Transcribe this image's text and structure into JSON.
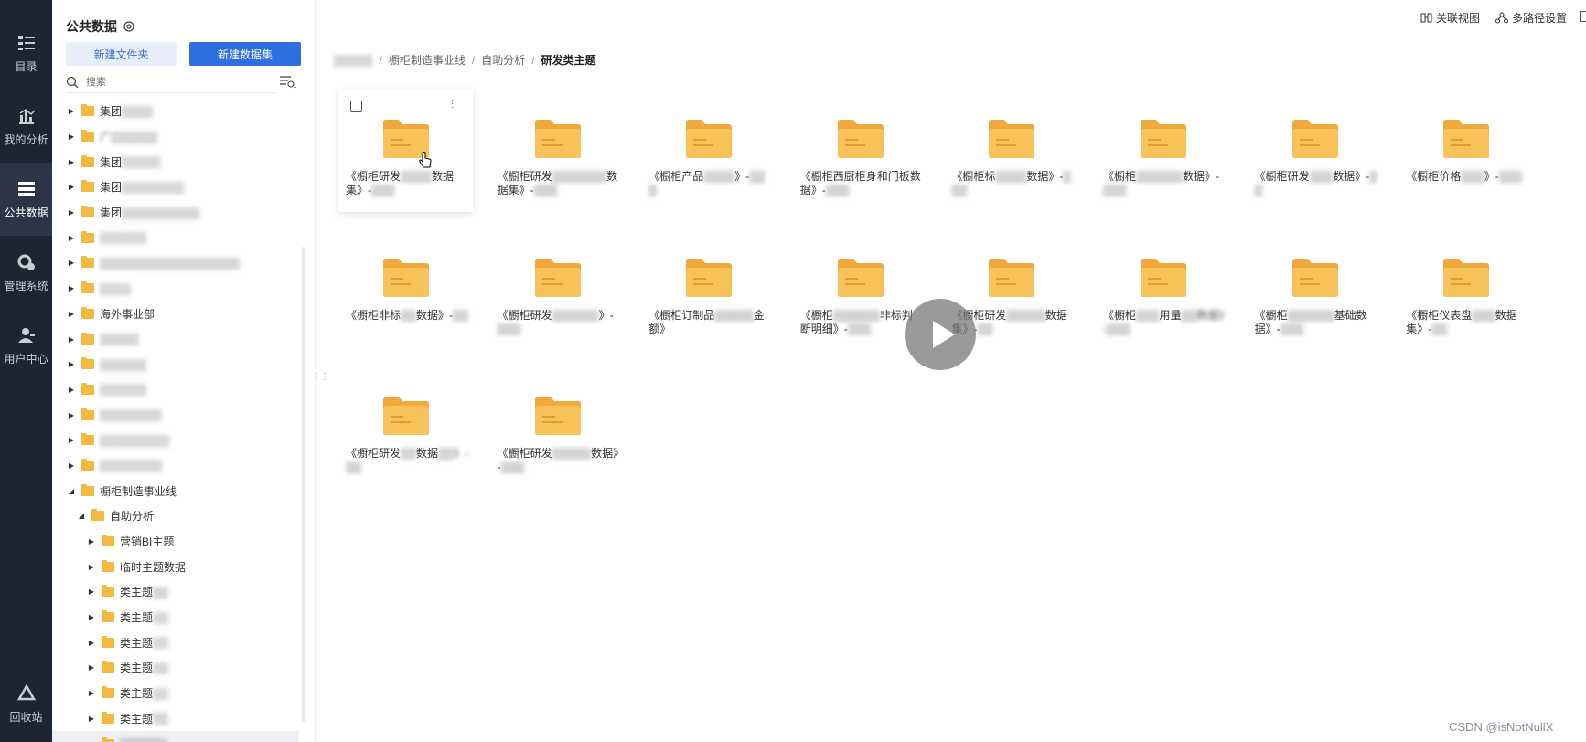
{
  "rail": {
    "items": [
      {
        "label": "目录",
        "icon": "catalog-icon"
      },
      {
        "label": "我的分析",
        "icon": "chart-icon"
      },
      {
        "label": "公共数据",
        "icon": "database-icon",
        "active": true
      },
      {
        "label": "管理系统",
        "icon": "settings-icon"
      },
      {
        "label": "用户中心",
        "icon": "user-icon"
      }
    ],
    "bottom": {
      "label": "回收站",
      "icon": "recycle-icon"
    }
  },
  "tree": {
    "title": "公共数据",
    "new_folder": "新建文件夹",
    "new_dataset": "新建数据集",
    "search_placeholder": "搜索",
    "rows": [
      {
        "label": "集团",
        "blur": "▒▒▒▒",
        "level": 0,
        "arrow": "▶"
      },
      {
        "label": "",
        "blur": "广▒▒▒▒▒▒",
        "level": 0,
        "arrow": "▶"
      },
      {
        "label": "集团",
        "blur": "▒▒▒▒▒",
        "level": 0,
        "arrow": "▶"
      },
      {
        "label": "集团",
        "blur": "▒▒▒▒▒▒▒▒",
        "level": 0,
        "arrow": "▶"
      },
      {
        "label": "集团",
        "blur": "▒▒▒▒▒▒▒▒▒▒",
        "level": 0,
        "arrow": "▶"
      },
      {
        "label": "",
        "blur": "▒▒▒▒▒▒",
        "level": 0,
        "arrow": "▶"
      },
      {
        "label": "",
        "blur": "▒▒▒▒▒▒▒▒▒▒▒▒▒▒▒▒▒▒",
        "level": 0,
        "arrow": "▶"
      },
      {
        "label": "",
        "blur": "▒▒▒▒",
        "level": 0,
        "arrow": "▶"
      },
      {
        "label": "海外事业部",
        "blur": "",
        "level": 0,
        "arrow": "▶"
      },
      {
        "label": "",
        "blur": "▒▒▒▒▒",
        "level": 0,
        "arrow": "▶"
      },
      {
        "label": "",
        "blur": "▒▒▒▒▒▒",
        "level": 0,
        "arrow": "▶"
      },
      {
        "label": "",
        "blur": "▒▒▒▒▒▒",
        "level": 0,
        "arrow": "▶"
      },
      {
        "label": "",
        "blur": "▒▒▒▒▒▒▒▒",
        "level": 0,
        "arrow": "▶"
      },
      {
        "label": "",
        "blur": "▒▒▒▒▒▒▒▒▒",
        "level": 0,
        "arrow": "▶"
      },
      {
        "label": "",
        "blur": "▒▒▒▒▒▒▒▒",
        "level": 0,
        "arrow": "▶"
      },
      {
        "label": "橱柜制造事业线",
        "blur": "",
        "level": 0,
        "arrow": "◢"
      },
      {
        "label": "自助分析",
        "blur": "",
        "level": 1,
        "arrow": "◢"
      },
      {
        "label": "营销BI主题",
        "blur": "",
        "level": 2,
        "arrow": "▶"
      },
      {
        "label": "临时主题数据",
        "blur": "",
        "level": 2,
        "arrow": "▶"
      },
      {
        "label": "类主题",
        "blur": "▒▒",
        "level": 2,
        "arrow": "▶"
      },
      {
        "label": "类主题",
        "blur": "▒▒",
        "level": 2,
        "arrow": "▶"
      },
      {
        "label": "类主题",
        "blur": "▒▒",
        "level": 2,
        "arrow": "▶"
      },
      {
        "label": "类主题",
        "blur": "▒▒",
        "level": 2,
        "arrow": "▶"
      },
      {
        "label": "类主题",
        "blur": "▒▒",
        "level": 2,
        "arrow": "▶"
      },
      {
        "label": "类主题",
        "blur": "▒▒",
        "level": 2,
        "arrow": "▶"
      },
      {
        "label": "",
        "blur": "▒▒▒▒▒▒",
        "level": 2,
        "arrow": "",
        "selected": true
      }
    ]
  },
  "topbar": {
    "related_view": "关联视图",
    "multipath": "多路径设置"
  },
  "breadcrumb": {
    "items": [
      "▒▒▒▒▒",
      "橱柜制造事业线",
      "自助分析"
    ],
    "current": "研发类主题"
  },
  "folders": [
    {
      "a": "《橱柜研发",
      "b": "▒▒▒▒",
      "c": "数据集》-",
      "d": "▒▒▒"
    },
    {
      "a": "《橱柜研发",
      "b": "▒▒▒▒▒▒▒",
      "c": "数据集》-",
      "d": "▒▒▒"
    },
    {
      "a": "《橱柜产品",
      "b": "▒▒▒▒",
      "c": "》-",
      "d": "▒▒▒"
    },
    {
      "a": "《橱柜西厨柜身和门板数据》-",
      "b": "",
      "c": "",
      "d": "▒▒▒"
    },
    {
      "a": "《橱柜标",
      "b": "▒▒▒▒",
      "c": "数据》-",
      "d": "▒▒▒"
    },
    {
      "a": "《橱柜",
      "b": "▒▒▒▒▒▒",
      "c": "数据》-",
      "d": "▒▒▒"
    },
    {
      "a": "《橱柜研发",
      "b": "▒▒▒",
      "c": "数据》-",
      "d": "▒▒"
    },
    {
      "a": "《橱柜价格",
      "b": "▒▒▒",
      "c": "》-",
      "d": "▒▒▒"
    },
    {
      "a": "《橱柜非标",
      "b": "▒▒",
      "c": "数据》-",
      "d": "▒▒"
    },
    {
      "a": "《橱柜研发",
      "b": "▒▒▒▒▒▒",
      "c": "》-",
      "d": "▒▒▒"
    },
    {
      "a": "《橱柜订制品",
      "b": "▒▒▒▒▒",
      "c": "金额》",
      "d": ""
    },
    {
      "a": "《橱柜",
      "b": "▒▒▒▒▒▒",
      "c": "非标判断明细》-",
      "d": "▒▒▒"
    },
    {
      "a": "《橱柜研发",
      "b": "▒▒▒▒▒",
      "c": "数据集》-",
      "d": "▒▒"
    },
    {
      "a": "《橱柜",
      "b": "▒▒▒",
      "c": "用量",
      "d": "▒▒数据》-▒▒▒"
    },
    {
      "a": "《橱柜",
      "b": "▒▒▒▒▒▒",
      "c": "基础数据》-",
      "d": "▒▒▒"
    },
    {
      "a": "《橱柜仪表盘",
      "b": "▒▒▒",
      "c": "数据集》-",
      "d": "▒▒"
    },
    {
      "a": "《橱柜研发",
      "b": "▒▒",
      "c": "数据",
      "d": "▒▒》-▒▒"
    },
    {
      "a": "《橱柜研发",
      "b": "▒▒▒▒▒",
      "c": "数据》-",
      "d": "▒▒▒"
    }
  ],
  "watermark": "CSDN @isNotNullX",
  "colors": {
    "rail": "#1f2433",
    "primary": "#2d6ee0",
    "folder": "#f5b940"
  }
}
